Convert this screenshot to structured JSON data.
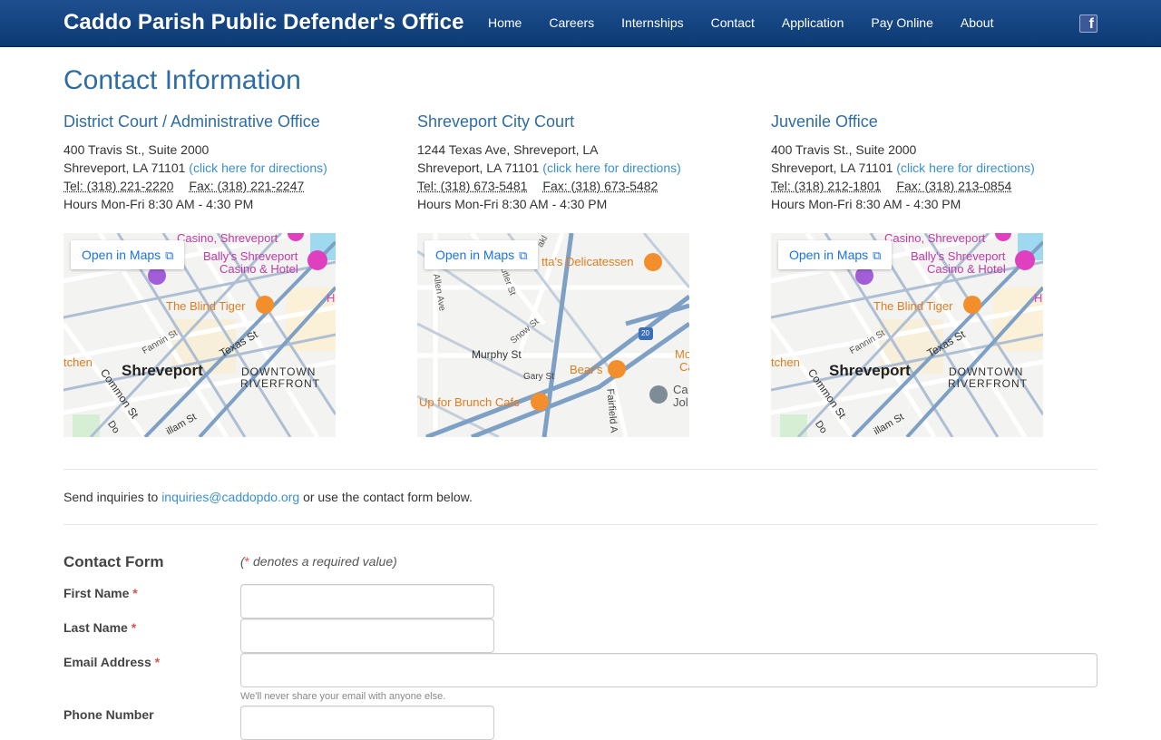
{
  "header": {
    "brand": "Caddo Parish Public Defender's Office",
    "nav": [
      "Home",
      "Careers",
      "Internships",
      "Contact",
      "Application",
      "Pay Online",
      "About"
    ],
    "social_icon": "facebook-icon",
    "social_glyph": "f",
    "colors": {
      "bar_top": "#1f4f8f",
      "bar_bottom": "#0b3a73"
    }
  },
  "page_title": "Contact Information",
  "offices": [
    {
      "name": "District Court / Administrative Office",
      "address1": "400 Travis St., Suite 2000",
      "address2": "Shreveport, LA 71101",
      "directions": "(click here for directions)",
      "tel": "Tel: (318) 221-2220",
      "fax": "Fax: (318) 221-2247",
      "hours": "Hours Mon-Fri 8:30 AM - 4:30 PM",
      "map": {
        "button": "Open in Maps",
        "labels": [
          "Casino, Shreveport",
          "Bally's Shreveport",
          "Casino & Hotel",
          "The Blind Tiger",
          "Fannin St",
          "tchen",
          "Shreveport",
          "Texas St",
          "DOWNTOWN",
          "RIVERFRONT",
          "Common St",
          "Do",
          "illam St",
          "H"
        ]
      }
    },
    {
      "name": "Shreveport City Court",
      "address1": "1244 Texas Ave, Shreveport, LA",
      "address2": "Shreveport, LA 71101",
      "directions": "(click here for directions)",
      "tel": "Tel: (318) 673-5481",
      "fax": "Fax: (318) 673-5482",
      "hours": "Hours Mon-Fri 8:30 AM - 4:30 PM",
      "map": {
        "button": "Open in Maps",
        "labels": [
          "tta's Delicatessen",
          "Allen Ave",
          "utler St",
          "Snow St",
          "Murphy St",
          "Gary St",
          "Bear's",
          "Up for Brunch Cafe",
          "Fairfield A",
          "Mo",
          "Ca",
          "Ca",
          "Jol",
          "20",
          "akl"
        ]
      }
    },
    {
      "name": "Juvenile Office",
      "address1": "400 Travis St., Suite 2000",
      "address2": "Shreveport, LA 71101",
      "directions": "(click here for directions)",
      "tel": "Tel: (318) 212-1801",
      "fax": "Fax: (318) 213-0854",
      "hours": "Hours Mon-Fri 8:30 AM - 4:30 PM",
      "map": {
        "button": "Open in Maps",
        "labels": [
          "Casino, Shreveport",
          "Bally's Shreveport",
          "Casino & Hotel",
          "The Blind Tiger",
          "Fannin St",
          "tchen",
          "Shreveport",
          "Texas St",
          "DOWNTOWN",
          "RIVERFRONT",
          "Common St",
          "Do",
          "illam St",
          "H"
        ]
      }
    }
  ],
  "inquiries": {
    "prefix": "Send inquiries to",
    "email": "inquiries@caddopdo.org",
    "suffix": "or use the contact form below."
  },
  "form": {
    "title": "Contact Form",
    "required_star": "*",
    "required_note": "denotes a required value)",
    "required_open": "(",
    "fields": [
      {
        "label": "First Name",
        "required": "*"
      },
      {
        "label": "Last Name",
        "required": "*"
      },
      {
        "label": "Email Address",
        "required": "*",
        "help": "We'll never share your email with anyone else."
      },
      {
        "label": "Phone Number",
        "required": ""
      }
    ]
  }
}
